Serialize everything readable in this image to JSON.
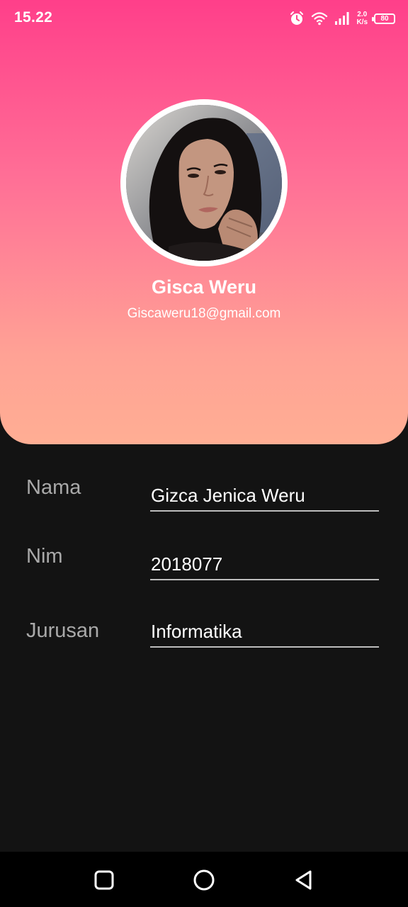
{
  "status_bar": {
    "time": "15.22",
    "speed_value": "2.0",
    "speed_unit": "K/s",
    "battery": "80",
    "icons": [
      "alarm-icon",
      "wifi-icon",
      "signal-icon",
      "battery-icon"
    ]
  },
  "profile": {
    "name": "Gisca Weru",
    "email": "Giscaweru18@gmail.com",
    "avatar": "profile-photo"
  },
  "form": {
    "rows": [
      {
        "label": "Nama",
        "value": "Gizca Jenica Weru"
      },
      {
        "label": "Nim",
        "value": "2018077"
      },
      {
        "label": "Jurusan",
        "value": "Informatika"
      }
    ]
  },
  "nav_bar": {
    "icons": [
      "recents-square-icon",
      "home-circle-icon",
      "back-triangle-icon"
    ]
  },
  "colors": {
    "gradient_top": "#ff3f8a",
    "gradient_bottom": "#ffae94",
    "background": "#131313",
    "label": "#a9a9a9",
    "underline": "#bdbdbd"
  }
}
